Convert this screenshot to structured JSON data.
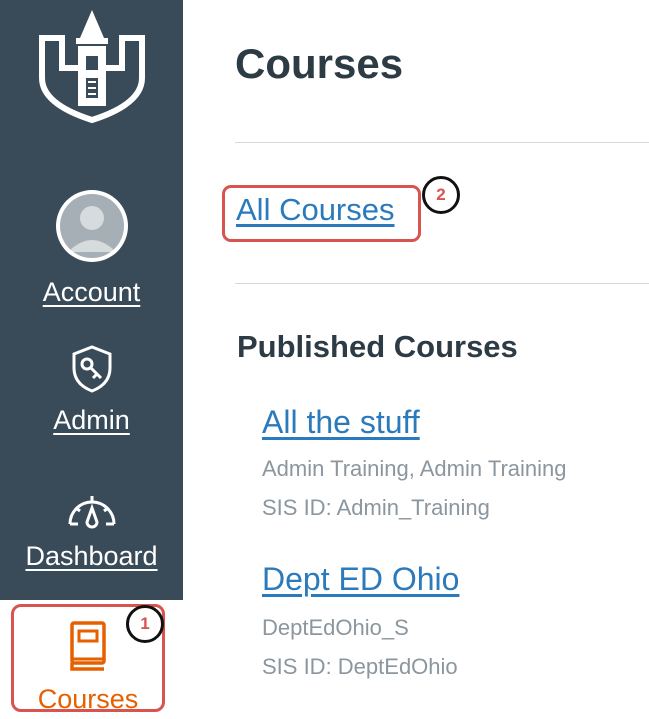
{
  "sidebar": {
    "logo_icon": "college-building-logo",
    "items": [
      {
        "id": "account",
        "label": "Account",
        "icon": "avatar-icon"
      },
      {
        "id": "admin",
        "label": "Admin",
        "icon": "shield-key-icon"
      },
      {
        "id": "dashboard",
        "label": "Dashboard",
        "icon": "speedometer-icon"
      },
      {
        "id": "courses",
        "label": "Courses",
        "icon": "book-icon",
        "active": true
      }
    ],
    "background_color": "#394B58",
    "active_color": "#E66000"
  },
  "annotations": {
    "badge_1": "1",
    "badge_2": "2",
    "highlight_color": "#D9534F"
  },
  "main": {
    "title": "Courses",
    "all_courses_link": "All Courses",
    "published_heading": "Published Courses",
    "courses": [
      {
        "name": "All the stuff",
        "term": "Admin Training, Admin Training",
        "sis": "SIS ID: Admin_Training"
      },
      {
        "name": "Dept ED Ohio",
        "term": "DeptEdOhio_S",
        "sis": "SIS ID: DeptEdOhio"
      }
    ],
    "link_color": "#2B7ABC"
  }
}
